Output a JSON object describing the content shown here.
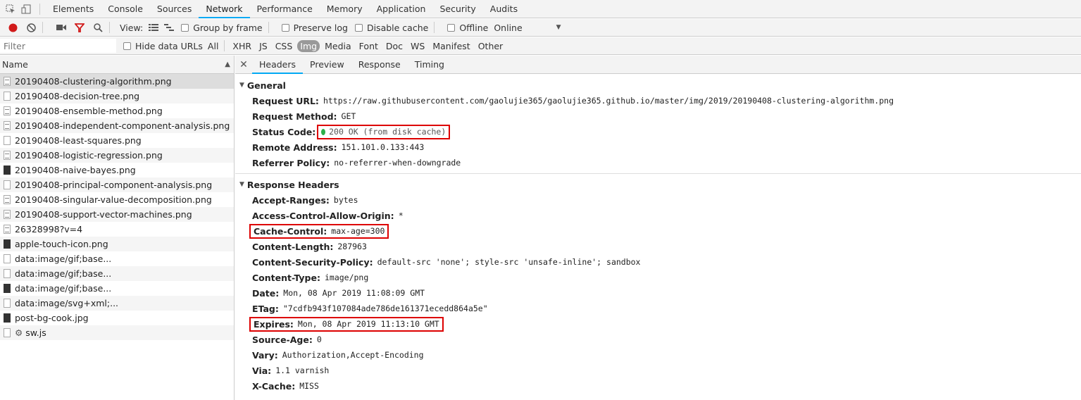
{
  "panel_tabs": [
    "Elements",
    "Console",
    "Sources",
    "Network",
    "Performance",
    "Memory",
    "Application",
    "Security",
    "Audits"
  ],
  "toolbar": {
    "view_label": "View:",
    "group_by_frame": "Group by frame",
    "preserve_log": "Preserve log",
    "disable_cache": "Disable cache",
    "offline": "Offline",
    "throttle": "Online"
  },
  "filterbar": {
    "placeholder": "Filter",
    "hide_data_urls": "Hide data URLs",
    "types": [
      "All",
      "XHR",
      "JS",
      "CSS",
      "Img",
      "Media",
      "Font",
      "Doc",
      "WS",
      "Manifest",
      "Other"
    ],
    "active_type": "Img"
  },
  "list": {
    "header": "Name",
    "items": [
      "20190408-clustering-algorithm.png",
      "20190408-decision-tree.png",
      "20190408-ensemble-method.png",
      "20190408-independent-component-analysis.png",
      "20190408-least-squares.png",
      "20190408-logistic-regression.png",
      "20190408-naive-bayes.png",
      "20190408-principal-component-analysis.png",
      "20190408-singular-value-decomposition.png",
      "20190408-support-vector-machines.png",
      "26328998?v=4",
      "apple-touch-icon.png",
      "data:image/gif;base...",
      "data:image/gif;base...",
      "data:image/gif;base...",
      "data:image/svg+xml;...",
      "post-bg-cook.jpg",
      "sw.js"
    ]
  },
  "detail_tabs": [
    "Headers",
    "Preview",
    "Response",
    "Timing"
  ],
  "general": {
    "title": "General",
    "request_url_k": "Request URL:",
    "request_url_v": "https://raw.githubusercontent.com/gaolujie365/gaolujie365.github.io/master/img/2019/20190408-clustering-algorithm.png",
    "request_method_k": "Request Method:",
    "request_method_v": "GET",
    "status_code_k": "Status Code:",
    "status_code_v": "200 OK (from disk cache)",
    "remote_address_k": "Remote Address:",
    "remote_address_v": "151.101.0.133:443",
    "referrer_policy_k": "Referrer Policy:",
    "referrer_policy_v": "no-referrer-when-downgrade"
  },
  "response_headers": {
    "title": "Response Headers",
    "rows": [
      {
        "k": "Accept-Ranges:",
        "v": "bytes"
      },
      {
        "k": "Access-Control-Allow-Origin:",
        "v": "*"
      },
      {
        "k": "Cache-Control:",
        "v": "max-age=300"
      },
      {
        "k": "Content-Length:",
        "v": "287963"
      },
      {
        "k": "Content-Security-Policy:",
        "v": "default-src 'none'; style-src 'unsafe-inline'; sandbox"
      },
      {
        "k": "Content-Type:",
        "v": "image/png"
      },
      {
        "k": "Date:",
        "v": "Mon, 08 Apr 2019 11:08:09 GMT"
      },
      {
        "k": "ETag:",
        "v": "\"7cdfb943f107084ade786de161371ecedd864a5e\""
      },
      {
        "k": "Expires:",
        "v": "Mon, 08 Apr 2019 11:13:10 GMT"
      },
      {
        "k": "Source-Age:",
        "v": "0"
      },
      {
        "k": "Vary:",
        "v": "Authorization,Accept-Encoding"
      },
      {
        "k": "Via:",
        "v": "1.1 varnish"
      },
      {
        "k": "X-Cache:",
        "v": "MISS"
      }
    ]
  },
  "colors": {
    "accent": "#03a9f4",
    "highlight_box": "#dd0000",
    "record": "#d11a1a",
    "status_ok": "#2db04a"
  }
}
